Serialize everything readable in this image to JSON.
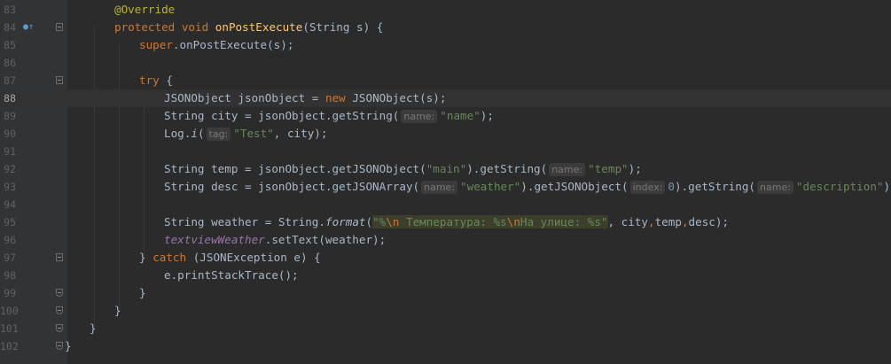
{
  "editor": {
    "override_marker_icon": "override-method-icon",
    "lines": [
      {
        "num": "83"
      },
      {
        "num": "84"
      },
      {
        "num": "85"
      },
      {
        "num": "86"
      },
      {
        "num": "87"
      },
      {
        "num": "88"
      },
      {
        "num": "89"
      },
      {
        "num": "90"
      },
      {
        "num": "91"
      },
      {
        "num": "92"
      },
      {
        "num": "93"
      },
      {
        "num": "94"
      },
      {
        "num": "95"
      },
      {
        "num": "96"
      },
      {
        "num": "97"
      },
      {
        "num": "98"
      },
      {
        "num": "99"
      },
      {
        "num": "100"
      },
      {
        "num": "101"
      },
      {
        "num": "102"
      }
    ],
    "tokens": {
      "annotation": "@Override",
      "protected": "protected",
      "void": "void",
      "onPostExecute": "onPostExecute",
      "sig_rest": "(String s) {",
      "super": "super",
      "super_call": ".onPostExecute(s);",
      "try": "try",
      "brace_open": " {",
      "l88_a": "JSONObject jsonObject = ",
      "new": "new",
      "l88_b": " JSONObject(s);",
      "l89_a": "String city = jsonObject.getString(",
      "hint_name": "name:",
      "str_name": "\"name\"",
      "close_paren_semi": ");",
      "l90_a": "Log.",
      "l90_i": "i",
      "l90_b": "(",
      "hint_tag": "tag:",
      "str_test": "\"Test\"",
      "l90_c": ", city);",
      "l92_a": "String temp = jsonObject.getJSONObject(",
      "str_main": "\"main\"",
      "l92_b": ").getString(",
      "str_temp": "\"temp\"",
      "l93_a": "String desc = jsonObject.getJSONArray(",
      "str_weather": "\"weather\"",
      "l93_b": ").getJSONObject(",
      "hint_index": "index:",
      "num_zero": "0",
      "l93_c": ").getString(",
      "str_description": "\"description\"",
      "l95_a": "String weather = String.",
      "format": "format",
      "l95_b": "(",
      "fmt_1": "\"%",
      "fmt_esc1": "\\n",
      "fmt_2": " Температура: %s",
      "fmt_esc2": "\\n",
      "fmt_3": "На улице: %s\"",
      "l95_c": ", city",
      "comma": ",",
      "temp": "temp",
      "desc_close": "desc);",
      "field_tv": "textviewWeather",
      "l96_b": ".setText(weather);",
      "close_brace": "}",
      "catch": "catch",
      "l97_b": " (JSONException e) {",
      "l98": "e.printStackTrace();"
    }
  }
}
